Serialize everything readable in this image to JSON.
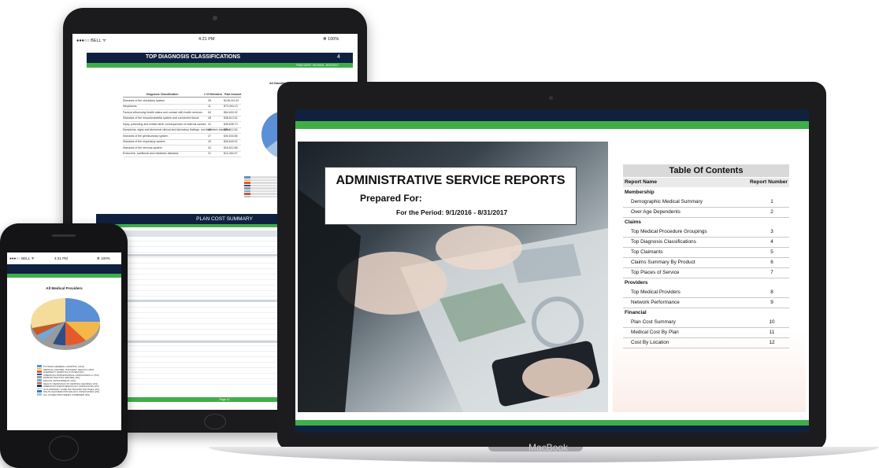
{
  "tablet": {
    "status": {
      "carrier": "●●●○○ BELL ᯤ",
      "time": "4:21 PM",
      "battery": "✻ 100%"
    },
    "report_title": "TOP DIAGNOSIS CLASSIFICATIONS",
    "page_number": "4",
    "paid_date": "PAID DATE: 9/1/2016 - 8/31/2017",
    "chart_title": "All Classifications",
    "table_header": {
      "col1": "Diagnosis Classification",
      "col2": "# Of Members",
      "col3": "Paid Amount"
    },
    "table_rows": [
      {
        "name": "Diseases of the circulatory system",
        "members": "28",
        "paid": "$148,211.02"
      },
      {
        "name": "Neoplasms",
        "members": "11",
        "paid": "$73,394.13"
      },
      {
        "name": "Factors influencing health status and contact with health services",
        "members": "63",
        "paid": "$64,600.92"
      },
      {
        "name": "Diseases of the musculoskeletal system and connective tissue",
        "members": "48",
        "paid": "$38,612.51"
      },
      {
        "name": "Injury, poisoning and certain other consequences of external causes",
        "members": "31",
        "paid": "$35,608.70"
      },
      {
        "name": "Symptoms, signs and abnormal clinical and laboratory findings, not elsewhere classified",
        "members": "48",
        "paid": "$32,412.64"
      },
      {
        "name": "Diseases of the genitourinary system",
        "members": "27",
        "paid": "$30,533.86"
      },
      {
        "name": "Diseases of the respiratory system",
        "members": "43",
        "paid": "$26,640.01"
      },
      {
        "name": "Diseases of the nervous system",
        "members": "20",
        "paid": "$16,512.85"
      },
      {
        "name": "Endocrine, nutritional and metabolic diseases",
        "members": "21",
        "paid": "$12,264.07"
      }
    ],
    "plan_cost_title": "PLAN COST SUMMARY",
    "footer_page": "Page 10"
  },
  "macbook": {
    "brand": "MacBook",
    "report_title": "ADMINISTRATIVE SERVICE REPORTS",
    "prepared_for": "Prepared For:",
    "period": "For the Period:  9/1/2016 - 8/31/2017",
    "toc": {
      "title": "Table Of Contents",
      "col_name": "Report Name",
      "col_number": "Report Number",
      "sections": [
        {
          "label": "Membership",
          "items": [
            {
              "name": "Demographic Medical Summary",
              "number": "1"
            },
            {
              "name": "Over Age Dependents",
              "number": "2"
            }
          ]
        },
        {
          "label": "Claims",
          "items": [
            {
              "name": "Top Medical Procedure Groupings",
              "number": "3"
            },
            {
              "name": "Top Diagnosis Classifications",
              "number": "4"
            },
            {
              "name": "Top Claimants",
              "number": "5"
            },
            {
              "name": "Claims Summary By Product",
              "number": "6"
            },
            {
              "name": "Top Places of Service",
              "number": "7"
            }
          ]
        },
        {
          "label": "Providers",
          "items": [
            {
              "name": "Top Medical Providers",
              "number": "8"
            },
            {
              "name": "Network Performance",
              "number": "9"
            }
          ]
        },
        {
          "label": "Financial",
          "items": [
            {
              "name": "Plan Cost Summary",
              "number": "10"
            },
            {
              "name": "Medical Cost By Plan",
              "number": "11"
            },
            {
              "name": "Cost By Location",
              "number": "12"
            }
          ]
        }
      ]
    }
  },
  "phone": {
    "status": {
      "carrier": "●●●○○ BELL ᯤ",
      "time": "4:21 PM",
      "battery": "✻ 100%"
    },
    "chart_title": "All Medical Providers",
    "legend": [
      {
        "label": "PUTNAM GENERAL HOSPITAL (41%)",
        "color": "#5b8fd6"
      },
      {
        "label": "MEDICAL CENTER, NAVICENT HEALTH (19%)",
        "color": "#f2b94a"
      },
      {
        "label": "GWINNETT HOSPITAL SYSTEM (9%)",
        "color": "#e35b2a"
      },
      {
        "label": "AMERICAN PROFESSIONAL ASSOCIATES LL (5%)",
        "color": "#2d4e87"
      },
      {
        "label": "EMSIUM DIALYSIS CENTER (3%)",
        "color": "#9a9a9a"
      },
      {
        "label": "MACON ORTHOPAEDIC (3%)",
        "color": "#6fa8dc"
      },
      {
        "label": "HEALTH SERVICES OF CENTRAL GEORGIA (2%)",
        "color": "#c55a28"
      },
      {
        "label": "AMERICAN ANESTHESIOLOGY ASSOCIATES (2%)",
        "color": "#1f3c6e"
      },
      {
        "label": "GCS PRIMARY CARE PHYSICIANS SOUTHEA (2%)",
        "color": "#d8d8d8"
      },
      {
        "label": "SOUTH EASTERN PATHOLOGY ASSOCIATES (2%)",
        "color": "#3f7cc4"
      },
      {
        "label": "ALL OTHER PROVIDERS COMBINED (8%)",
        "color": "#a7c1e6"
      }
    ]
  },
  "colors": {
    "navy": "#10213f",
    "green": "#3fae49"
  }
}
